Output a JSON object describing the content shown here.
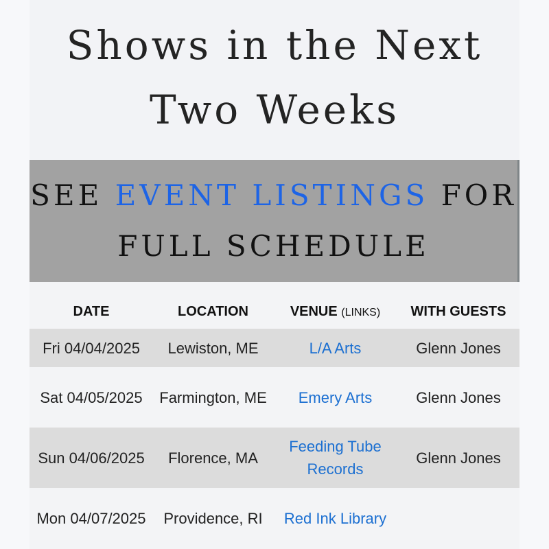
{
  "hero": {
    "line1": "Shows in the Next",
    "line2": "Two Weeks"
  },
  "banner": {
    "see": "SEE",
    "link": "EVENT LISTINGS",
    "for": "FOR",
    "line2": "FULL SCHEDULE"
  },
  "table": {
    "headers": {
      "date": "DATE",
      "location": "LOCATION",
      "venue": "VENUE",
      "venue_note": "(LINKS)",
      "guests": "WITH GUESTS"
    },
    "rows": [
      {
        "date": "Fri 04/04/2025",
        "location": "Lewiston, ME",
        "venue": "L/A Arts",
        "guests": "Glenn Jones"
      },
      {
        "date": "Sat 04/05/2025",
        "location": "Farmington, ME",
        "venue": "Emery Arts",
        "guests": "Glenn Jones"
      },
      {
        "date": "Sun 04/06/2025",
        "location": "Florence, MA",
        "venue": "Feeding Tube Records",
        "guests": "Glenn Jones"
      },
      {
        "date": "Mon 04/07/2025",
        "location": "Providence, RI",
        "venue": "Red Ink Library",
        "guests": ""
      }
    ]
  },
  "colors": {
    "link": "#1b6fd1",
    "banner_link": "#1d64e6",
    "banner_bg": "#a2a2a2",
    "row_shade": "#dcdcdc"
  }
}
